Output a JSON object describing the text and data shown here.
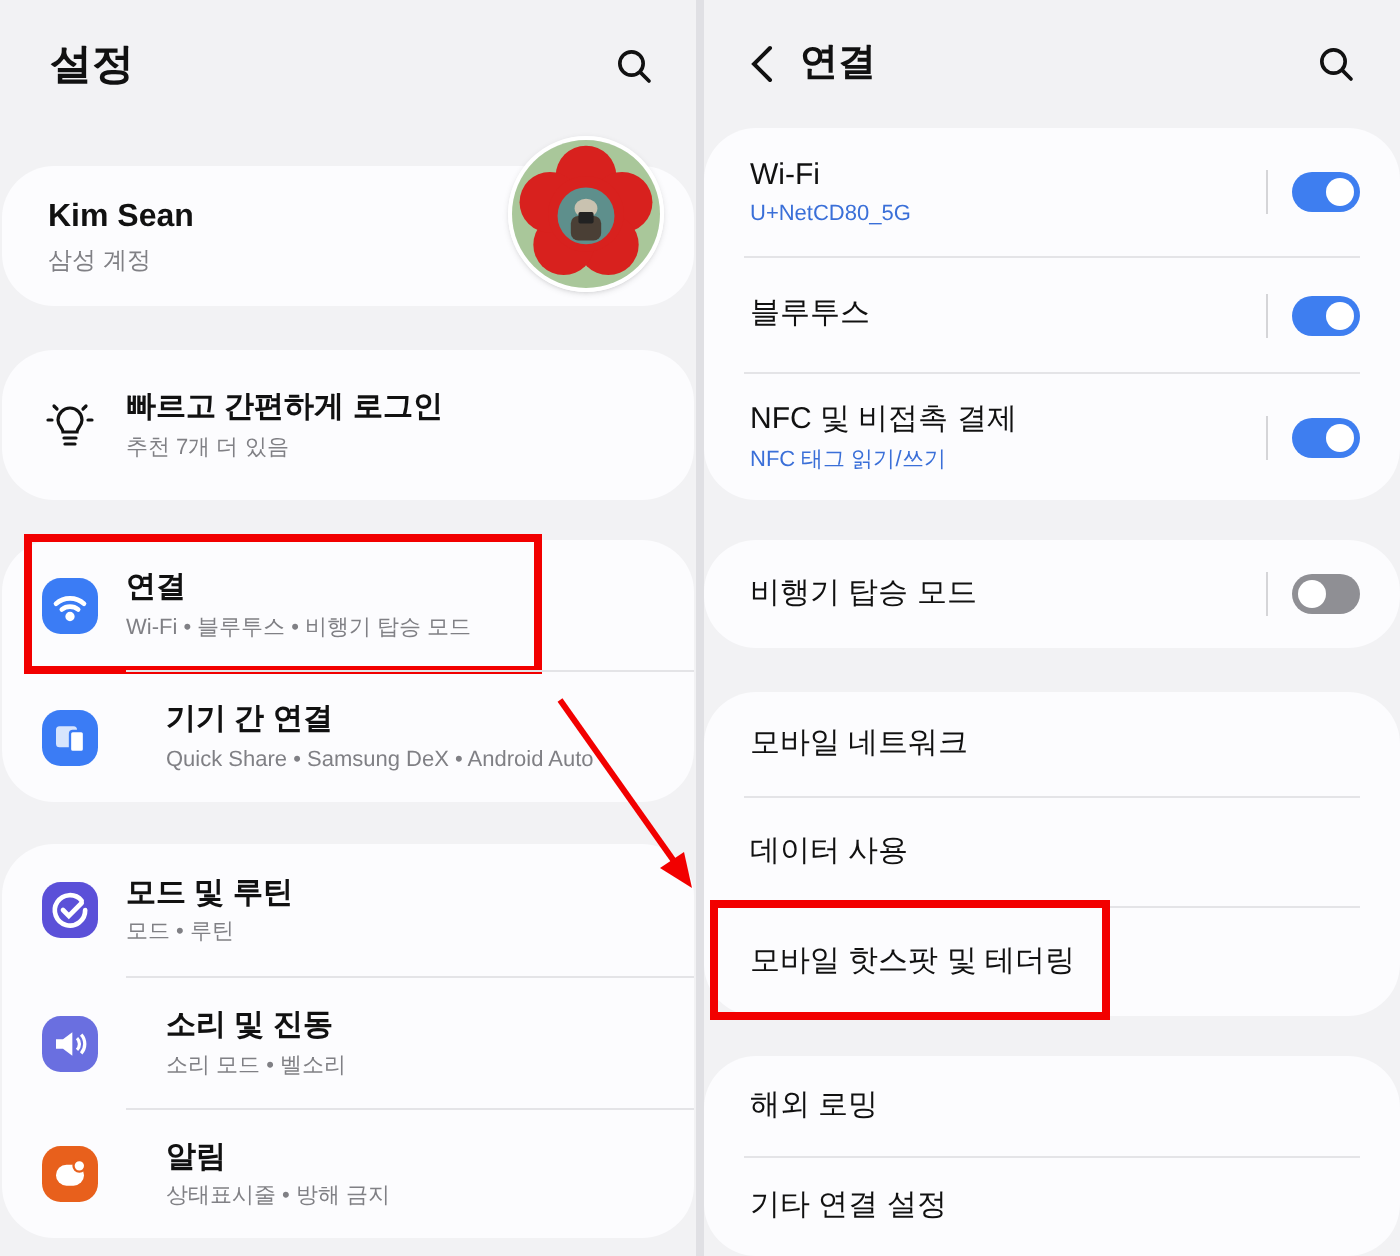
{
  "left": {
    "title": "설정",
    "profile": {
      "name": "Kim Sean",
      "subtitle": "삼성 계정"
    },
    "suggestion": {
      "title": "빠르고 간편하게 로그인",
      "subtitle": "추천 7개 더 있음"
    },
    "groups": [
      {
        "items": [
          {
            "title": "연결",
            "subtitle": "Wi-Fi • 블루투스 • 비행기 탑승 모드",
            "highlighted": true
          },
          {
            "title": "기기 간 연결",
            "subtitle": "Quick Share • Samsung DeX • Android Auto",
            "highlighted": false
          }
        ]
      },
      {
        "items": [
          {
            "title": "모드 및 루틴",
            "subtitle": "모드 • 루틴",
            "highlighted": false
          },
          {
            "title": "소리 및 진동",
            "subtitle": "소리 모드 • 벨소리",
            "highlighted": false
          },
          {
            "title": "알림",
            "subtitle": "상태표시줄 • 방해 금지",
            "highlighted": false
          }
        ]
      }
    ]
  },
  "right": {
    "title": "연결",
    "groups": [
      {
        "items": [
          {
            "kind": "toggle",
            "title": "Wi-Fi",
            "subtitle": "U+NetCD80_5G",
            "on": true,
            "highlighted": false
          },
          {
            "kind": "toggle",
            "title": "블루투스",
            "on": true,
            "highlighted": false
          },
          {
            "kind": "toggle",
            "title": "NFC 및 비접촉 결제",
            "subtitle": "NFC 태그 읽기/쓰기",
            "on": true,
            "highlighted": false
          }
        ]
      },
      {
        "items": [
          {
            "kind": "toggle",
            "title": "비행기 탑승 모드",
            "on": false,
            "highlighted": false
          }
        ]
      },
      {
        "items": [
          {
            "kind": "link",
            "title": "모바일 네트워크",
            "highlighted": false
          },
          {
            "kind": "link",
            "title": "데이터 사용",
            "highlighted": false
          },
          {
            "kind": "link",
            "title": "모바일 핫스팟 및 테더링",
            "highlighted": true
          }
        ]
      },
      {
        "items": [
          {
            "kind": "link",
            "title": "해외 로밍",
            "highlighted": false
          },
          {
            "kind": "link",
            "title": "기타 연결 설정",
            "highlighted": false
          }
        ]
      }
    ]
  }
}
